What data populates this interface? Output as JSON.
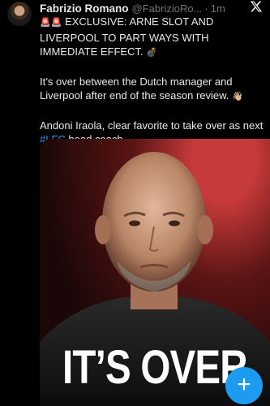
{
  "tweet": {
    "display_name": "Fabrizio Romano",
    "handle": "@FabrizioRo...",
    "separator": "·",
    "time": "1m",
    "paragraph1_emoji": "🚨🚨",
    "paragraph1": "EXCLUSIVE: ARNE SLOT AND LIVERPOOL TO PART WAYS WITH IMMEDIATE EFFECT.",
    "paragraph1_end_emoji": "💣",
    "paragraph2": "It’s over between the Dutch manager and Liverpool after end of the season review.",
    "paragraph2_emoji": "👋🏼",
    "paragraph3_before": "Andoni Iraola, clear favorite to take over as next ",
    "hashtag": "#LFC",
    "paragraph3_after": " head coach.",
    "media_caption": "IT’S OVER"
  },
  "icons": {
    "x_logo": "x-logo-icon",
    "compose": "plus-icon"
  },
  "colors": {
    "background": "#000000",
    "text": "#e7e9ea",
    "muted": "#71767b",
    "accent": "#1d9bf0"
  }
}
